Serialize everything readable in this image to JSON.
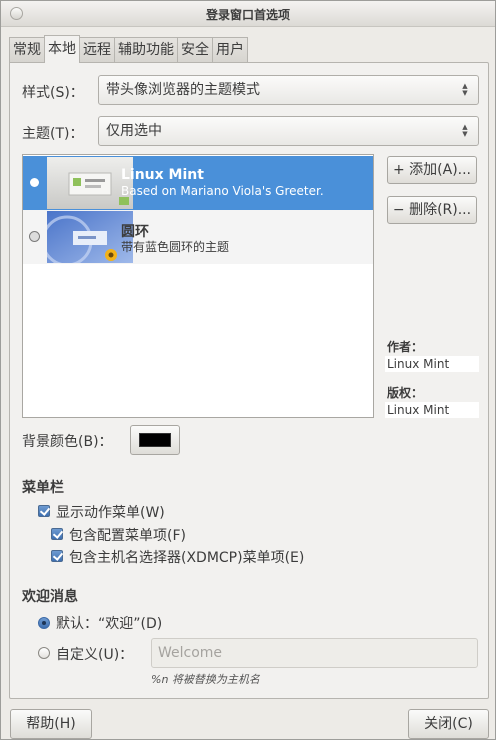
{
  "window": {
    "title": "登录窗口首选项"
  },
  "tabs": [
    {
      "label": "常规"
    },
    {
      "label": "本地"
    },
    {
      "label": "远程"
    },
    {
      "label": "辅助功能"
    },
    {
      "label": "安全"
    },
    {
      "label": "用户"
    }
  ],
  "active_tab": "本地",
  "style_row": {
    "label": "样式(S)：",
    "value": "带头像浏览器的主题模式"
  },
  "theme_row": {
    "label": "主题(T)：",
    "value": "仅用选中"
  },
  "themes": [
    {
      "name": "Linux Mint",
      "description": "Based on Mariano Viola's Greeter.",
      "selected": true
    },
    {
      "name": "圆环",
      "description": "带有蓝色圆环的主题",
      "selected": false
    }
  ],
  "buttons": {
    "add": "添加(A)...",
    "remove": "删除(R)...",
    "help": "帮助(H)",
    "close": "关闭(C)"
  },
  "meta": {
    "author_label": "作者：",
    "author_value": "Linux Mint",
    "copyright_label": "版权：",
    "copyright_value": "Linux Mint"
  },
  "background": {
    "label": "背景颜色(B)：",
    "color": "#000000"
  },
  "menubar": {
    "title": "菜单栏",
    "show_actions": "显示动作菜单(W)",
    "include_config": "包含配置菜单项(F)",
    "include_chooser": "包含主机名选择器(XDMCP)菜单项(E)"
  },
  "welcome": {
    "title": "欢迎消息",
    "default_label": "默认：“欢迎”(D)",
    "custom_label": "自定义(U)：",
    "custom_placeholder": "Welcome",
    "hint": "%n 将被替换为主机名"
  },
  "colors": {
    "selection": "#4a90d9",
    "window_bg": "#edebe7"
  }
}
